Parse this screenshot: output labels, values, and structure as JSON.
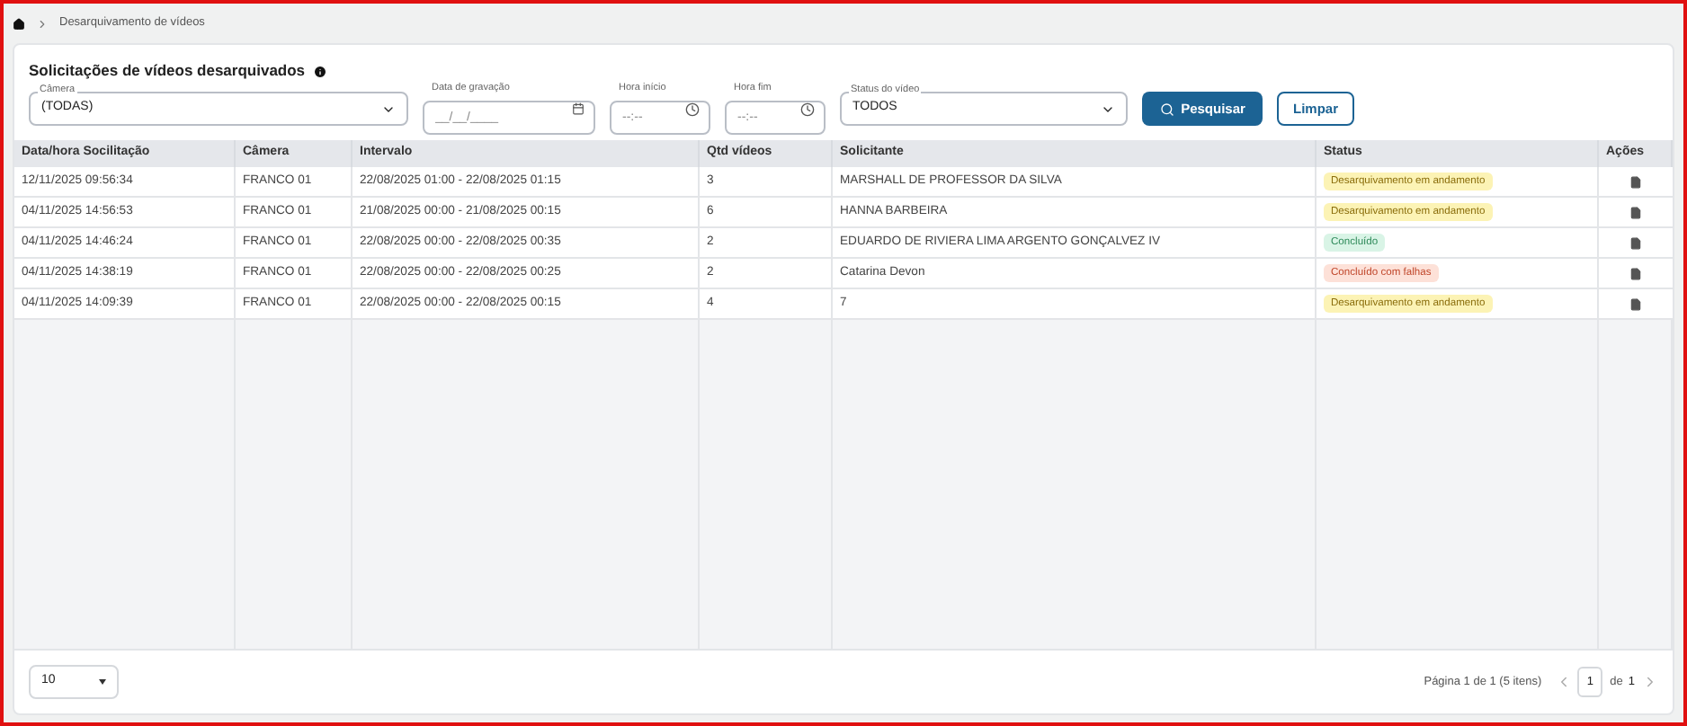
{
  "breadcrumb": {
    "current": "Desarquivamento de vídeos"
  },
  "title": "Solicitações de vídeos desarquivados",
  "filters": {
    "camera": {
      "label": "Câmera",
      "value": "(TODAS)"
    },
    "date": {
      "label": "Data de gravação",
      "placeholder": "__/__/____"
    },
    "start": {
      "label": "Hora início",
      "placeholder": "--:--"
    },
    "end": {
      "label": "Hora fim",
      "placeholder": "--:--"
    },
    "status": {
      "label": "Status do vídeo",
      "value": "TODOS"
    },
    "search_button": "Pesquisar",
    "clear_button": "Limpar"
  },
  "table": {
    "columns": [
      "Data/hora Socilitação",
      "Câmera",
      "Intervalo",
      "Qtd vídeos",
      "Solicitante",
      "Status",
      "Ações"
    ],
    "rows": [
      {
        "date": "12/11/2025 09:56:34",
        "camera": "FRANCO 01",
        "interval": "22/08/2025 01:00 - 22/08/2025 01:15",
        "count": "3",
        "requester": "MARSHALL DE PROFESSOR DA SILVA",
        "status": "Desarquivamento em andamento",
        "kind": "progress"
      },
      {
        "date": "04/11/2025 14:56:53",
        "camera": "FRANCO 01",
        "interval": "21/08/2025 00:00 - 21/08/2025 00:15",
        "count": "6",
        "requester": "HANNA BARBEIRA",
        "status": "Desarquivamento em andamento",
        "kind": "progress"
      },
      {
        "date": "04/11/2025 14:46:24",
        "camera": "FRANCO 01",
        "interval": "22/08/2025 00:00 - 22/08/2025 00:35",
        "count": "2",
        "requester": "EDUARDO DE RIVIERA LIMA ARGENTO GONÇALVEZ IV",
        "status": "Concluído",
        "kind": "done"
      },
      {
        "date": "04/11/2025 14:38:19",
        "camera": "FRANCO 01",
        "interval": "22/08/2025 00:00 - 22/08/2025 00:25",
        "count": "2",
        "requester": "Catarina Devon",
        "status": "Concluído com falhas",
        "kind": "failed"
      },
      {
        "date": "04/11/2025 14:09:39",
        "camera": "FRANCO 01",
        "interval": "22/08/2025 00:00 - 22/08/2025 00:15",
        "count": "4",
        "requester": "7",
        "status": "Desarquivamento em andamento",
        "kind": "progress"
      }
    ]
  },
  "footer": {
    "page_size": "10",
    "summary": "Página 1 de 1 (5 itens)",
    "page": "1",
    "of": "de",
    "total": "1"
  }
}
